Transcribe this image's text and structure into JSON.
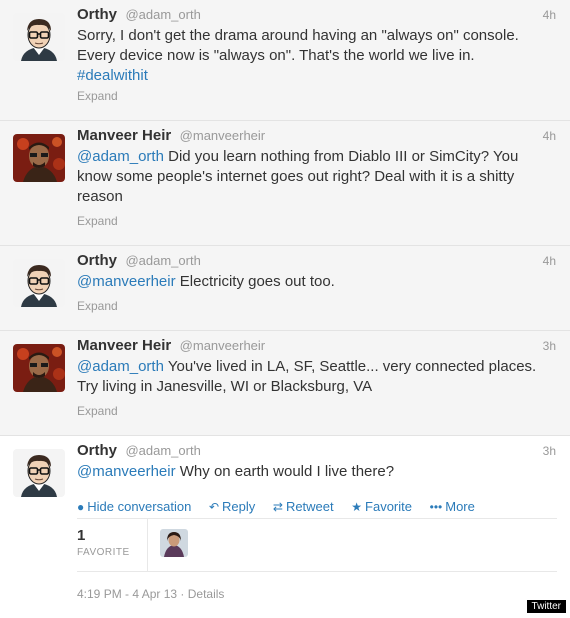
{
  "tweets": [
    {
      "fullname": "Orthy",
      "username": "@adam_orth",
      "time": "4h",
      "text_line1": "Sorry, I don't get the drama around having an \"always on\" console.",
      "text_line2": "Every device now is \"always on\". That's the world we live in.",
      "hashtag": "#dealwithit",
      "expand": "Expand",
      "avatar": "cartoon-glasses-avatar"
    },
    {
      "fullname": "Manveer Heir",
      "username": "@manveerheir",
      "time": "4h",
      "mention": "@adam_orth",
      "text_line1_rest": " Did you learn nothing from Diablo III or SimCity? You",
      "text_line2": "know some people's internet goes out right? Deal with it is a shitty",
      "text_line3": "reason",
      "expand": "Expand",
      "avatar": "photo-avatar-red"
    },
    {
      "fullname": "Orthy",
      "username": "@adam_orth",
      "time": "4h",
      "mention": "@manveerheir",
      "text_rest": " Electricity goes out too.",
      "expand": "Expand",
      "avatar": "cartoon-glasses-avatar"
    },
    {
      "fullname": "Manveer Heir",
      "username": "@manveerheir",
      "time": "3h",
      "mention": "@adam_orth",
      "text_line1_rest": " You've lived in LA, SF, Seattle... very connected places.",
      "text_line2": "Try living in Janesville, WI or Blacksburg, VA",
      "expand": "Expand",
      "avatar": "photo-avatar-red"
    },
    {
      "fullname": "Orthy",
      "username": "@adam_orth",
      "time": "3h",
      "mention": "@manveerheir",
      "text_rest": " Why on earth would I live there?",
      "avatar": "cartoon-glasses-avatar",
      "actions": {
        "hide_conversation": "Hide conversation",
        "reply": "Reply",
        "retweet": "Retweet",
        "favorite": "Favorite",
        "more": "More"
      },
      "stats": {
        "favorites_count": "1",
        "favorites_label": "FAVORITE"
      },
      "timestamp": "4:19 PM - 4 Apr 13",
      "separator": " · ",
      "details": "Details"
    }
  ],
  "watermark": "Twitter",
  "colors": {
    "link": "#2b7bb9",
    "muted": "#999999",
    "bg_collapsed": "#f5f5f5"
  }
}
